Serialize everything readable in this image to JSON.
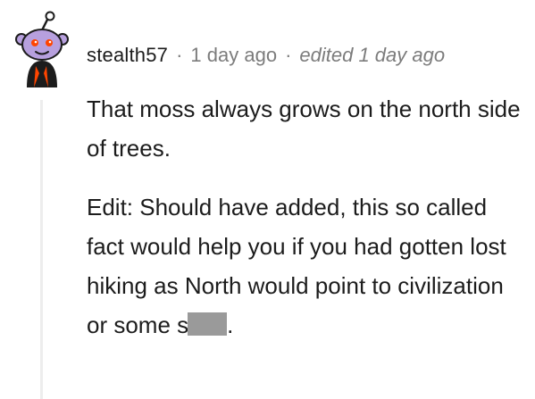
{
  "comment": {
    "username": "stealth57",
    "separator": "·",
    "posted_time": "1 day ago",
    "edited_label": "edited 1 day ago",
    "avatar_icon": "snoo-avatar-icon",
    "paragraphs": [
      "That moss always grows on the north side of trees.",
      "Edit: Should have added, this so called fact would help you if you had gotten lost hiking as North would point to civilization or some"
    ],
    "trailing_visible_text": "s",
    "trailing_punctuation": ".",
    "censored_word": true
  },
  "colors": {
    "text": "#1c1c1c",
    "meta": "#7c7c7c",
    "thread_line": "#ededed",
    "avatar_accent": "#ff4500",
    "avatar_face": "#b7a0de"
  }
}
